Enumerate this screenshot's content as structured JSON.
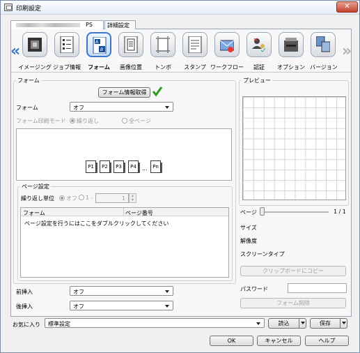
{
  "window": {
    "title": "印刷設定",
    "close": "✕"
  },
  "tabs": [
    {
      "label": "PS"
    },
    {
      "label": "詳細設定"
    }
  ],
  "icons": [
    {
      "label": "イメージング",
      "icon": "imaging-icon"
    },
    {
      "label": "ジョブ情報",
      "icon": "job-info-icon"
    },
    {
      "label": "フォーム",
      "icon": "form-icon",
      "selected": true
    },
    {
      "label": "画像位置",
      "icon": "image-position-icon"
    },
    {
      "label": "トンボ",
      "icon": "crop-marks-icon"
    },
    {
      "label": "スタンプ",
      "icon": "stamp-icon"
    },
    {
      "label": "ワークフロー",
      "icon": "workflow-icon"
    },
    {
      "label": "認証",
      "icon": "authentication-icon"
    },
    {
      "label": "オプション",
      "icon": "option-icon"
    },
    {
      "label": "バージョン",
      "icon": "version-icon"
    }
  ],
  "nav": {
    "prev": "«",
    "next": "»"
  },
  "form_group": {
    "title": "フォーム",
    "get_info_button": "フォーム情報取得",
    "form_label": "フォーム",
    "form_value": "オフ",
    "print_mode_label": "フォーム印刷モード",
    "print_mode_options": [
      "繰り返し",
      "全ページ"
    ],
    "print_mode_selected": "繰り返し",
    "pages": [
      "P1",
      "P2",
      "P3",
      "P4",
      "...",
      "Pn"
    ]
  },
  "page_setting": {
    "title": "ページ設定",
    "repeat_unit_label": "繰り返し単位",
    "repeat_off": "オフ",
    "repeat_range_start": "1 -",
    "repeat_range_value": "1",
    "columns": [
      "フォーム",
      "ページ番号"
    ],
    "hint": "ページ設定を行うにはここをダブルクリックしてください"
  },
  "insert": {
    "front_label": "前挿入",
    "front_value": "オフ",
    "back_label": "後挿入",
    "back_value": "オフ"
  },
  "preview": {
    "title": "プレビュー",
    "page_label": "ページ",
    "page_count": "1 / 1",
    "size_label": "サイズ",
    "resolution_label": "解像度",
    "screen_type_label": "スクリーンタイプ",
    "copy_button": "クリップボードにコピー",
    "password_label": "パスワード",
    "password_value": "",
    "delete_button": "フォーム削除"
  },
  "favorites": {
    "label": "お気に入り",
    "value": "標準設定",
    "load_button": "読込",
    "save_button": "保存"
  },
  "footer": {
    "ok": "OK",
    "cancel": "キャンセル",
    "help": "ヘルプ"
  },
  "colors": {
    "accent": "#3a78c9",
    "check": "#2e9b1f",
    "close": "#c4432e"
  }
}
